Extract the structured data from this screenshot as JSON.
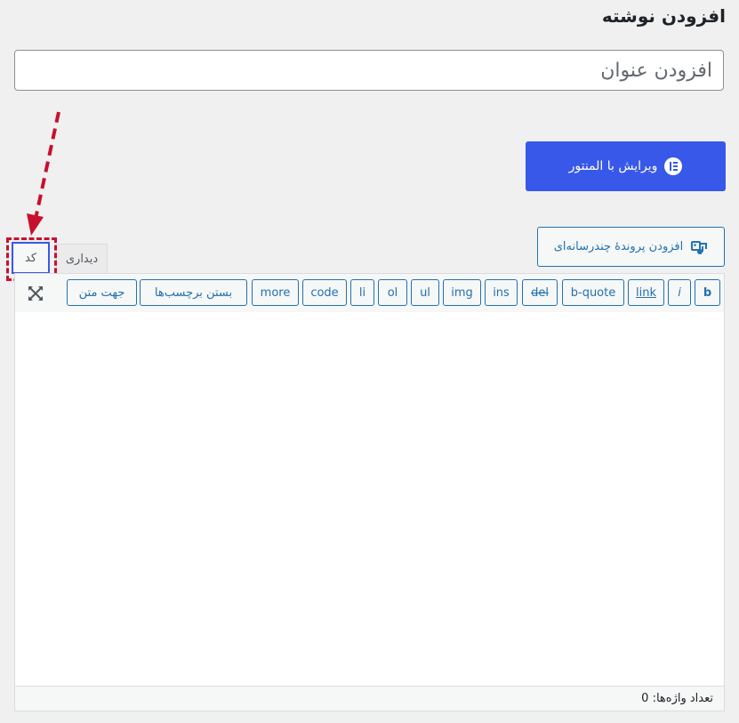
{
  "page": {
    "title": "افزودن نوشته"
  },
  "post_title": {
    "placeholder": "افزودن عنوان"
  },
  "elementor": {
    "label": "ویرایش با المنتور",
    "icon": "elementor-icon",
    "color": "#3858e9"
  },
  "media": {
    "label": "افزودن پروندهٔ چندرسانه‌ای",
    "icon": "media-icon"
  },
  "tabs": {
    "visual": "دیداری",
    "code": "کد"
  },
  "toolbar": {
    "buttons": {
      "b": "b",
      "i": "i",
      "link": "link",
      "bquote": "b-quote",
      "del": "del",
      "ins": "ins",
      "img": "img",
      "ul": "ul",
      "ol": "ol",
      "li": "li",
      "code": "code",
      "more": "more",
      "close_tags": "بستن برچسب‌ها",
      "direction": "جهت متن"
    },
    "fullscreen_icon": "fullscreen-icon"
  },
  "status": {
    "word_count": "تعداد واژه‌ها: 0"
  },
  "annotation": {
    "color": "#c8102e"
  }
}
